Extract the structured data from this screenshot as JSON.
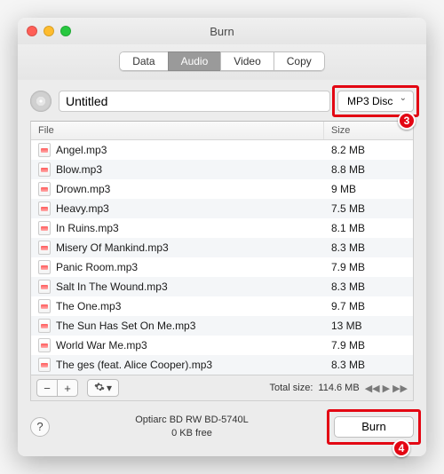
{
  "window": {
    "title": "Burn"
  },
  "tabs": [
    "Data",
    "Audio",
    "Video",
    "Copy"
  ],
  "active_tab": 1,
  "disc": {
    "title_value": "Untitled",
    "type_selected": "MP3 Disc"
  },
  "columns": {
    "file": "File",
    "size": "Size"
  },
  "files": [
    {
      "name": "Angel.mp3",
      "size": "8.2 MB"
    },
    {
      "name": "Blow.mp3",
      "size": "8.8 MB"
    },
    {
      "name": "Drown.mp3",
      "size": "9 MB"
    },
    {
      "name": "Heavy.mp3",
      "size": "7.5 MB"
    },
    {
      "name": "In Ruins.mp3",
      "size": "8.1 MB"
    },
    {
      "name": "Misery Of Mankind.mp3",
      "size": "8.3 MB"
    },
    {
      "name": "Panic Room.mp3",
      "size": "7.9 MB"
    },
    {
      "name": "Salt In The Wound.mp3",
      "size": "8.3 MB"
    },
    {
      "name": "The One.mp3",
      "size": "9.7 MB"
    },
    {
      "name": "The Sun Has Set On Me.mp3",
      "size": "13 MB"
    },
    {
      "name": "World War Me.mp3",
      "size": "7.9 MB"
    },
    {
      "name": "The ges (feat. Alice Cooper).mp3",
      "size": "8.3 MB"
    }
  ],
  "totals": {
    "label": "Total size:",
    "value": "114.6 MB"
  },
  "drive": {
    "name": "Optiarc BD RW BD-5740L",
    "free": "0 KB free"
  },
  "buttons": {
    "remove": "−",
    "add": "+",
    "gear_arrow": "▾",
    "help": "?",
    "burn": "Burn"
  },
  "transport": {
    "prev": "◀◀",
    "play": "▶",
    "next": "▶▶"
  },
  "callouts": {
    "type_badge": "3",
    "burn_badge": "4"
  },
  "colors": {
    "highlight": "#e30613"
  }
}
